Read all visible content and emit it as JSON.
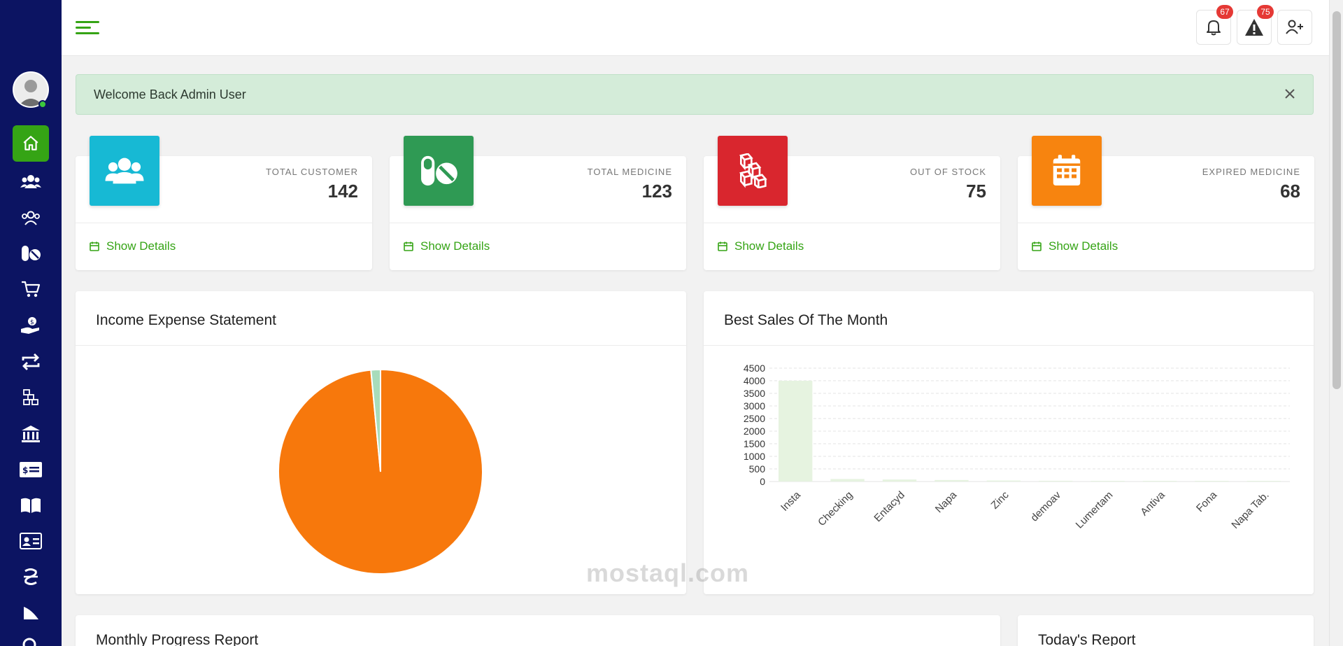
{
  "alert": {
    "text": "Welcome Back Admin User"
  },
  "notifications": {
    "bell_count": "67",
    "warning_count": "75"
  },
  "stats": [
    {
      "label": "TOTAL CUSTOMER",
      "value": "142",
      "link": "Show Details",
      "color": "#17b9d4",
      "icon": "users-icon"
    },
    {
      "label": "TOTAL MEDICINE",
      "value": "123",
      "link": "Show Details",
      "color": "#2f9a54",
      "icon": "pills-icon"
    },
    {
      "label": "OUT OF STOCK",
      "value": "75",
      "link": "Show Details",
      "color": "#d9262e",
      "icon": "boxes-icon"
    },
    {
      "label": "EXPIRED MEDICINE",
      "value": "68",
      "link": "Show Details",
      "color": "#f7840f",
      "icon": "calendar-icon"
    }
  ],
  "panels": {
    "income": {
      "title": "Income Expense Statement"
    },
    "sales": {
      "title": "Best Sales Of The Month"
    },
    "monthly": {
      "title": "Monthly Progress Report"
    },
    "today": {
      "title": "Today's Report"
    }
  },
  "watermark": "mostaql.com",
  "chart_data": [
    {
      "type": "pie",
      "title": "Income Expense Statement",
      "slices": [
        {
          "value": 98.5,
          "color": "#f7780c"
        },
        {
          "value": 1.5,
          "color": "#a8dcbb"
        }
      ]
    },
    {
      "type": "bar",
      "title": "Best Sales Of The Month",
      "categories": [
        "Insta",
        "Checking",
        "Entacyd",
        "Napa",
        "Zinc",
        "demoav",
        "Lumertam",
        "Antiva",
        "Fona",
        "Napa Tab."
      ],
      "values": [
        4000,
        100,
        80,
        60,
        40,
        30,
        15,
        10,
        5,
        5
      ],
      "ylim": [
        0,
        4500
      ],
      "yticks": [
        "0",
        "500",
        "1000",
        "1500",
        "2000",
        "2500",
        "3000",
        "3500",
        "4000",
        "4500"
      ],
      "bar_color": "#e6f3e0",
      "grid": true
    }
  ]
}
